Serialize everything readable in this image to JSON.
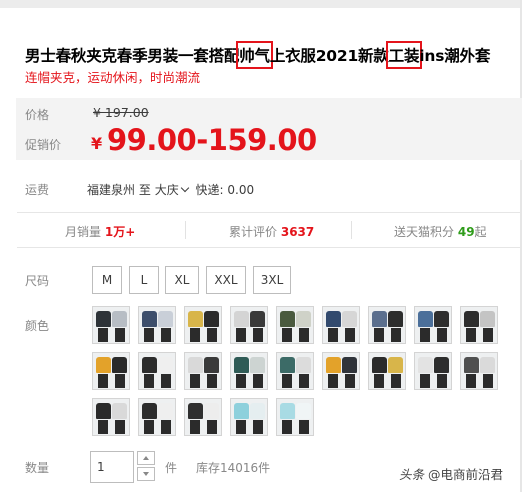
{
  "title": {
    "part1": "男士春秋夹克春季男装一套搭配",
    "hl1": "帅气",
    "part2": "上衣服2021新款",
    "hl2": "工装",
    "part3": "ins潮外套"
  },
  "subtitle": "连帽夹克，运动休闲，时尚潮流",
  "price": {
    "label": "价格",
    "original": "¥ 197.00",
    "promo_label": "促销价",
    "currency": "¥",
    "promo": "99.00-159.00"
  },
  "shipping": {
    "label": "运费",
    "from": "福建泉州",
    "to_prefix": "至",
    "to": "大庆",
    "fee": "快递: 0.00"
  },
  "stats": {
    "monthly_label": "月销量",
    "monthly_value": "1万+",
    "reviews_label": "累计评价",
    "reviews_value": "3637",
    "points_label": "送天猫积分",
    "points_value": "49",
    "points_suffix": "起"
  },
  "sizes": {
    "label": "尺码",
    "options": [
      "M",
      "L",
      "XL",
      "XXL",
      "3XL"
    ]
  },
  "colors": {
    "label": "颜色",
    "swatches": [
      [
        "#2e3338",
        "#b7bdc4"
      ],
      [
        "#3d4e6b",
        "#c9cfd8"
      ],
      [
        "#d8b54a",
        "#2b2b2b"
      ],
      [
        "#d4d4d4",
        "#3a3a3a"
      ],
      [
        "#4a5a3e",
        "#cfd2c8"
      ],
      [
        "#324a6e",
        "#d6d6d6"
      ],
      [
        "#5b6f8e",
        "#2d2d2d"
      ],
      [
        "#4b6f9a",
        "#2e2e2e"
      ],
      [
        "#2d2d2d",
        "#c4c4c4"
      ],
      [
        "#e3a22a",
        "#2a2a2a"
      ],
      [
        "#2c2c2c",
        "#efefef"
      ],
      [
        "#d9d9d9",
        "#3a3a3a"
      ],
      [
        "#2f5b56",
        "#cdd4d2"
      ],
      [
        "#3c6b67",
        "#dcdcdc"
      ],
      [
        "#e3a22a",
        "#30343a"
      ],
      [
        "#2b2b2b",
        "#d8b54a"
      ],
      [
        "#e3e3e3",
        "#2d2d2d"
      ],
      [
        "#505050",
        "#dadada"
      ],
      [
        "#2a2a2a",
        "#d9d9d9"
      ],
      [
        "#2c2c2c",
        "#efefef"
      ],
      [
        "#2f2f2f",
        "#ededed"
      ],
      [
        "#8ed0dc",
        "#e5eef0"
      ],
      [
        "#a8dbe4",
        "#f0f5f6"
      ]
    ]
  },
  "quantity": {
    "label": "数量",
    "value": "1",
    "unit": "件",
    "stock": "库存14016件"
  },
  "watermark": {
    "source": "头条",
    "author": "@电商前沿君"
  }
}
